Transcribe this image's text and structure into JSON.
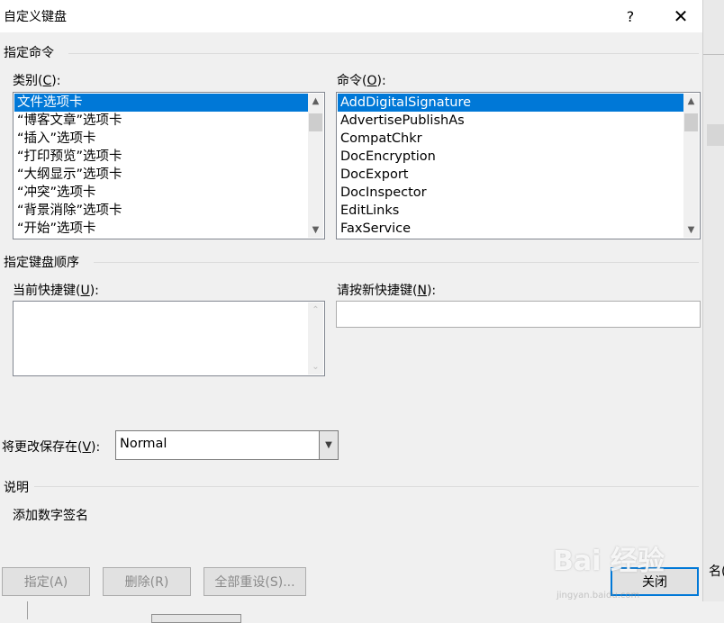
{
  "dialog": {
    "title": "自定义键盘",
    "help_label": "?",
    "close_label": "✕"
  },
  "specify_command": {
    "group_label": "指定命令",
    "categories": {
      "label_prefix": "类别(",
      "label_key": "C",
      "label_suffix": "):",
      "items": [
        "文件选项卡",
        "“博客文章”选项卡",
        "“插入”选项卡",
        "“打印预览”选项卡",
        "“大纲显示”选项卡",
        "“冲突”选项卡",
        "“背景消除”选项卡",
        "“开始”选项卡"
      ],
      "selected_index": 0
    },
    "commands": {
      "label_prefix": "命令(",
      "label_key": "O",
      "label_suffix": "):",
      "items": [
        "AddDigitalSignature",
        "AdvertisePublishAs",
        "CompatChkr",
        "DocEncryption",
        "DocExport",
        "DocInspector",
        "EditLinks",
        "FaxService"
      ],
      "selected_index": 0
    }
  },
  "keyboard_sequence": {
    "group_label": "指定键盘顺序",
    "current_keys": {
      "label_prefix": "当前快捷键(",
      "label_key": "U",
      "label_suffix": "):"
    },
    "new_key": {
      "label_prefix": "请按新快捷键(",
      "label_key": "N",
      "label_suffix": "):",
      "value": ""
    }
  },
  "save_in": {
    "label_prefix": "将更改保存在(",
    "label_key": "V",
    "label_suffix": "):",
    "value": "Normal"
  },
  "description": {
    "group_label": "说明",
    "text": "添加数字签名"
  },
  "buttons": {
    "assign": "指定(A)",
    "remove": "删除(R)",
    "reset_all": "全部重设(S)...",
    "close": "关闭"
  },
  "background": {
    "right_text": "名("
  },
  "watermark": {
    "text": "Bai 经验",
    "sub": "jingyan.baidu.com"
  },
  "colors": {
    "selection": "#0078d7",
    "dialog_bg": "#f0f0f0"
  }
}
